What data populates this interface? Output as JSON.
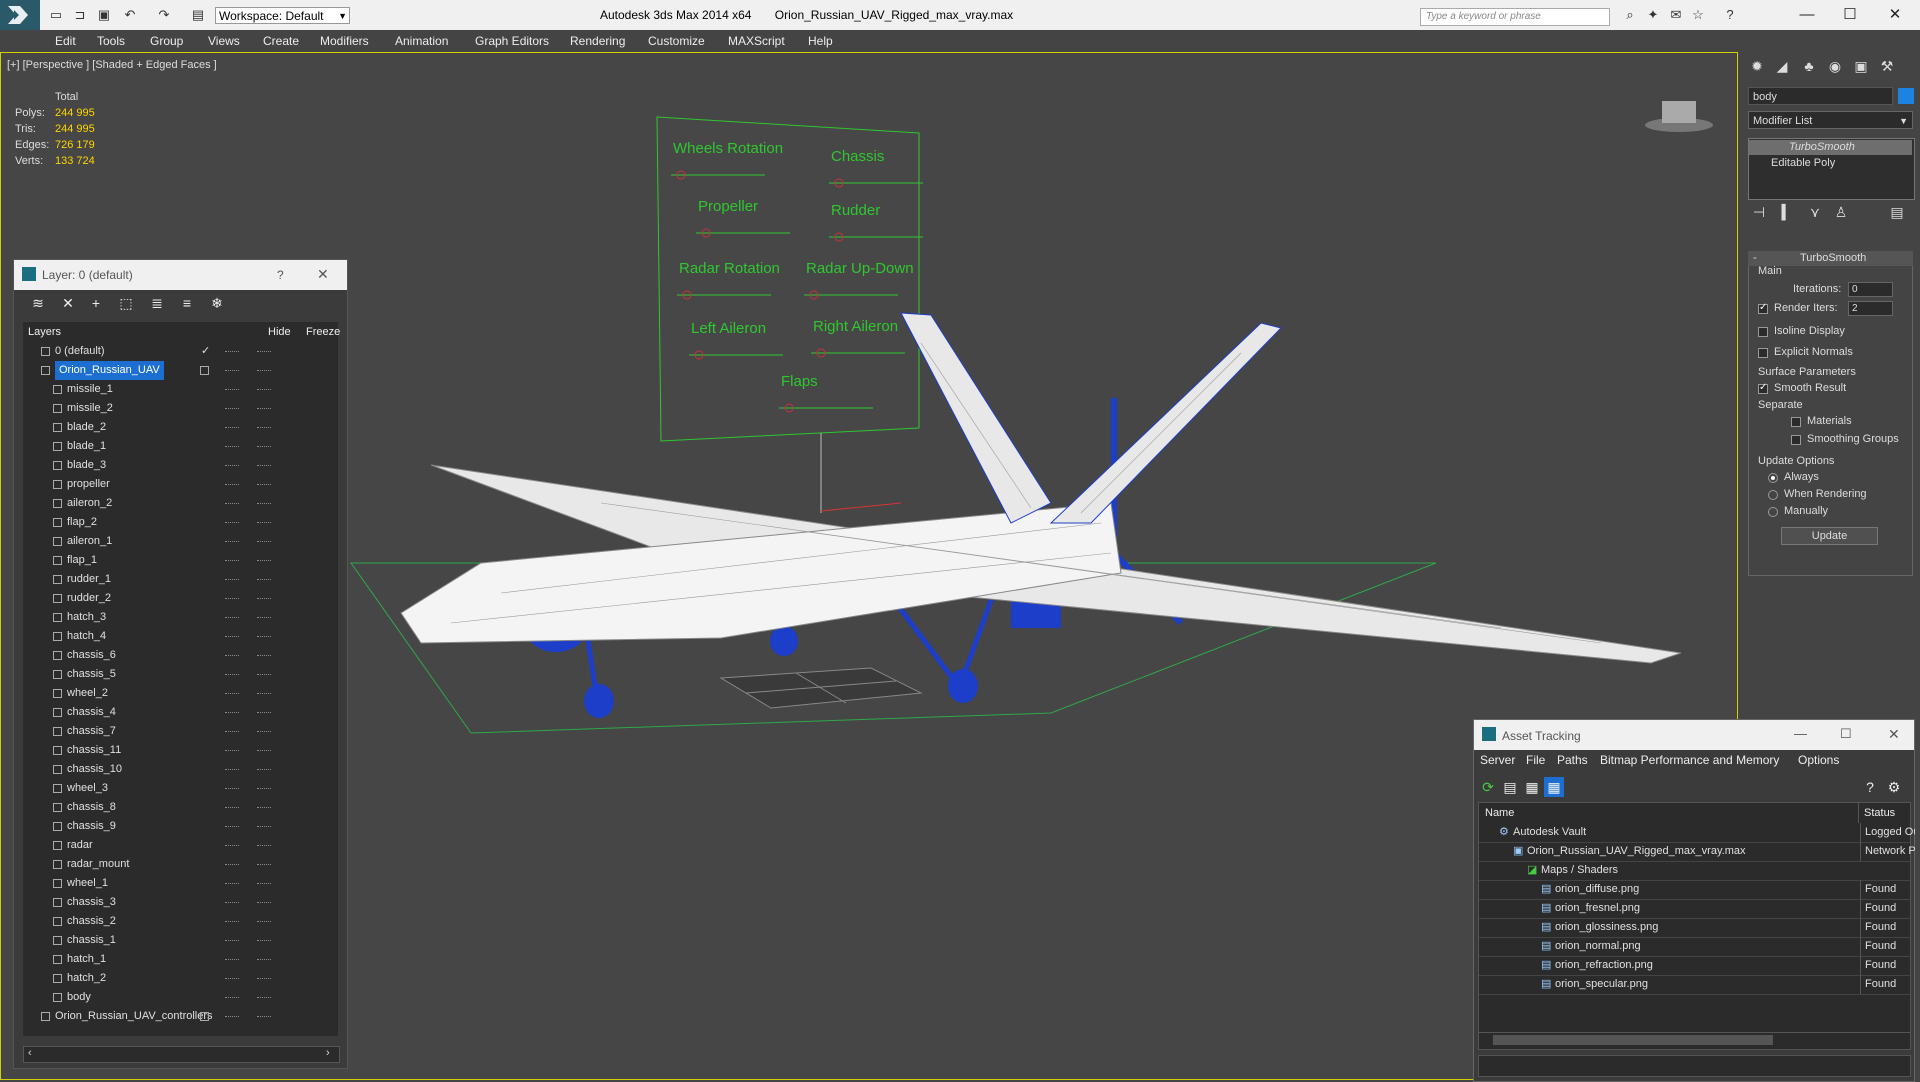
{
  "titlebar": {
    "workspace": "Workspace: Default",
    "app_name": "Autodesk 3ds Max  2014 x64",
    "file_name": "Orion_Russian_UAV_Rigged_max_vray.max",
    "search_placeholder": "Type a keyword or phrase"
  },
  "menubar": [
    "Edit",
    "Tools",
    "Group",
    "Views",
    "Create",
    "Modifiers",
    "Animation",
    "Graph Editors",
    "Rendering",
    "Customize",
    "MAXScript",
    "Help"
  ],
  "viewport": {
    "label": "[+] [Perspective ] [Shaded + Edged Faces ]",
    "stats": {
      "header": "Total",
      "polys_label": "Polys:",
      "polys": "244 995",
      "tris_label": "Tris:",
      "tris": "244 995",
      "edges_label": "Edges:",
      "edges": "726 179",
      "verts_label": "Verts:",
      "verts": "133 724"
    },
    "controller_labels": [
      "Wheels Rotation",
      "Chassis",
      "Propeller",
      "Rudder",
      "Radar Rotation",
      "Radar Up-Down",
      "Left Aileron",
      "Right Aileron",
      "Flaps"
    ]
  },
  "layer_panel": {
    "title": "Layer: 0 (default)",
    "help": "?",
    "col_layers": "Layers",
    "col_hide": "Hide",
    "col_freeze": "Freeze",
    "layers": [
      {
        "name": "0 (default)",
        "level": 0
      },
      {
        "name": "Orion_Russian_UAV",
        "level": 0,
        "selected": true
      },
      {
        "name": "missile_1",
        "level": 1
      },
      {
        "name": "missile_2",
        "level": 1
      },
      {
        "name": "blade_2",
        "level": 1
      },
      {
        "name": "blade_1",
        "level": 1
      },
      {
        "name": "blade_3",
        "level": 1
      },
      {
        "name": "propeller",
        "level": 1
      },
      {
        "name": "aileron_2",
        "level": 1
      },
      {
        "name": "flap_2",
        "level": 1
      },
      {
        "name": "aileron_1",
        "level": 1
      },
      {
        "name": "flap_1",
        "level": 1
      },
      {
        "name": "rudder_1",
        "level": 1
      },
      {
        "name": "rudder_2",
        "level": 1
      },
      {
        "name": "hatch_3",
        "level": 1
      },
      {
        "name": "hatch_4",
        "level": 1
      },
      {
        "name": "chassis_6",
        "level": 1
      },
      {
        "name": "chassis_5",
        "level": 1
      },
      {
        "name": "wheel_2",
        "level": 1
      },
      {
        "name": "chassis_4",
        "level": 1
      },
      {
        "name": "chassis_7",
        "level": 1
      },
      {
        "name": "chassis_11",
        "level": 1
      },
      {
        "name": "chassis_10",
        "level": 1
      },
      {
        "name": "wheel_3",
        "level": 1
      },
      {
        "name": "chassis_8",
        "level": 1
      },
      {
        "name": "chassis_9",
        "level": 1
      },
      {
        "name": "radar",
        "level": 1
      },
      {
        "name": "radar_mount",
        "level": 1
      },
      {
        "name": "wheel_1",
        "level": 1
      },
      {
        "name": "chassis_3",
        "level": 1
      },
      {
        "name": "chassis_2",
        "level": 1
      },
      {
        "name": "chassis_1",
        "level": 1
      },
      {
        "name": "hatch_1",
        "level": 1
      },
      {
        "name": "hatch_2",
        "level": 1
      },
      {
        "name": "body",
        "level": 1
      },
      {
        "name": "Orion_Russian_UAV_controllers",
        "level": 0
      }
    ]
  },
  "command_panel": {
    "object_name": "body",
    "object_color": "#1c84e0",
    "modifier_list": "Modifier List",
    "stack": [
      "TurboSmooth",
      "Editable Poly"
    ],
    "turbosmooth": {
      "title": "TurboSmooth",
      "main": "Main",
      "iterations_label": "Iterations:",
      "iterations": "0",
      "render_iters_label": "Render Iters:",
      "render_iters": "2",
      "isoline": "Isoline Display",
      "explicit_normals": "Explicit Normals",
      "surface_params": "Surface Parameters",
      "smooth_result": "Smooth Result",
      "separate": "Separate",
      "materials": "Materials",
      "smoothing_groups": "Smoothing Groups",
      "update_options": "Update Options",
      "always": "Always",
      "when_rendering": "When Rendering",
      "manually": "Manually",
      "update_btn": "Update"
    }
  },
  "asset_tracking": {
    "title": "Asset Tracking",
    "menu": [
      "Server",
      "File",
      "Paths",
      "Bitmap Performance and Memory",
      "Options"
    ],
    "col_name": "Name",
    "col_status": "Status",
    "rows": [
      {
        "name": "Autodesk Vault",
        "status": "Logged Out",
        "level": 0
      },
      {
        "name": "Orion_Russian_UAV_Rigged_max_vray.max",
        "status": "Network Path",
        "level": 1
      },
      {
        "name": "Maps / Shaders",
        "status": "",
        "level": 2
      },
      {
        "name": "orion_diffuse.png",
        "status": "Found",
        "level": 3
      },
      {
        "name": "orion_fresnel.png",
        "status": "Found",
        "level": 3
      },
      {
        "name": "orion_glossiness.png",
        "status": "Found",
        "level": 3
      },
      {
        "name": "orion_normal.png",
        "status": "Found",
        "level": 3
      },
      {
        "name": "orion_refraction.png",
        "status": "Found",
        "level": 3
      },
      {
        "name": "orion_specular.png",
        "status": "Found",
        "level": 3
      }
    ]
  },
  "colors": {
    "selection": "#1c6fd1",
    "stats_value": "#ffd400",
    "controller_text": "#2fc72f",
    "wireframe": "#ffffff",
    "gear": "#1c3ec8"
  }
}
